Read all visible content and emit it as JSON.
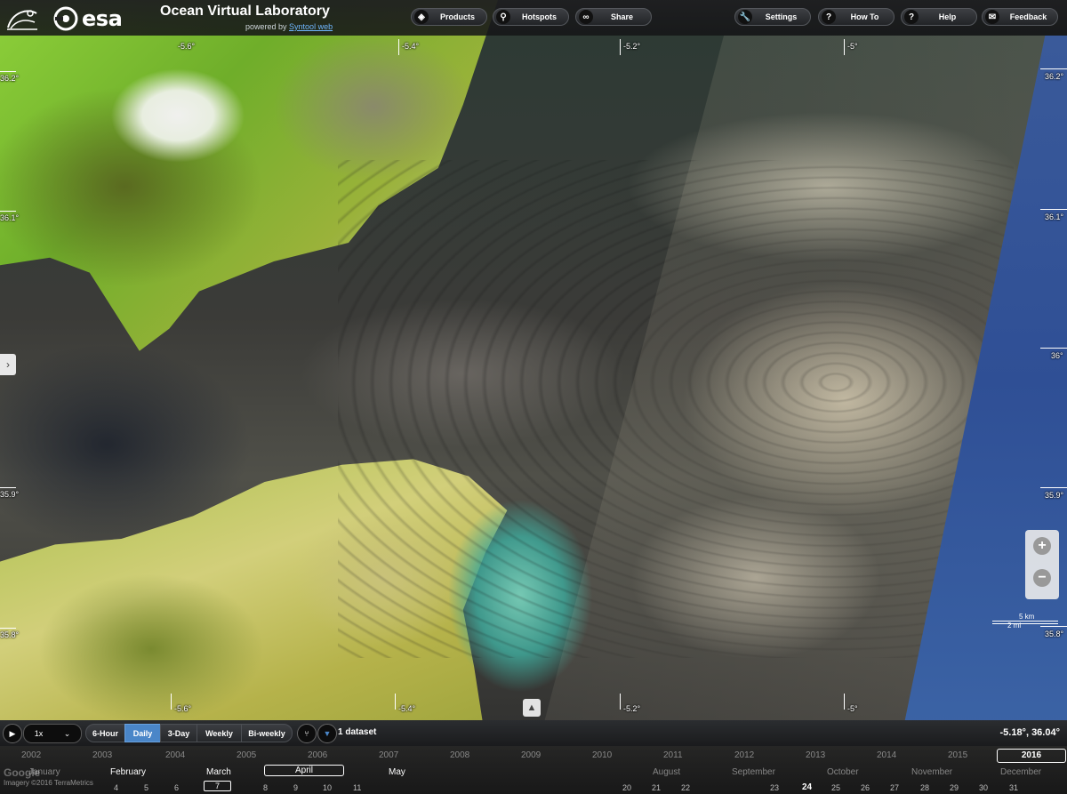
{
  "header": {
    "app_title": "Ocean Virtual Laboratory",
    "powered_by": "powered by",
    "powered_link": "Syntool web",
    "esa_logo_text": "esa",
    "buttons": {
      "products": "Products",
      "hotspots": "Hotspots",
      "share": "Share",
      "settings": "Settings",
      "howto": "How To",
      "help": "Help",
      "feedback": "Feedback"
    }
  },
  "grid": {
    "lon_top": [
      "-5.4°",
      "-5.2°",
      "-5°"
    ],
    "lat_right": [
      "36.2°",
      "36.1°",
      "36°",
      "35.9°",
      "35.8°"
    ],
    "lat_left": [
      "36.2°",
      "36.1°",
      "36°",
      "35.9°",
      "35.8°"
    ],
    "lon_bottom": [
      "-5.6°",
      "-5.4°",
      "-5.2°",
      "-5°"
    ],
    "lon_top_left": "-5.6°"
  },
  "map_overlay": {
    "scale_km": "5 km",
    "scale_mi": "2 mi"
  },
  "timeline_bar": {
    "speed": "1x",
    "periods": [
      "6-Hour",
      "Daily",
      "3-Day",
      "Weekly",
      "Bi-weekly"
    ],
    "active_period": "Daily",
    "datasets": "1 dataset",
    "cursor_position": "-5.18°, 36.04°"
  },
  "timeline": {
    "years": [
      "2002",
      "2003",
      "2004",
      "2005",
      "2006",
      "2007",
      "2008",
      "2009",
      "2010",
      "2011",
      "2012",
      "2013",
      "2014",
      "2015",
      "2016"
    ],
    "current_year": "2016",
    "months": [
      "January",
      "February",
      "March",
      "April",
      "May",
      "August",
      "September",
      "October",
      "November",
      "December"
    ],
    "selected_month": "April",
    "days": [
      "4",
      "5",
      "6",
      "7",
      "8",
      "9",
      "10",
      "11",
      "20",
      "21",
      "22",
      "23",
      "24",
      "25",
      "26",
      "27",
      "28",
      "29",
      "30",
      "31"
    ],
    "selected_day": "7",
    "highlight_day": "24",
    "map_credit": "Imagery ©2016 TerraMetrics",
    "google_mark": "Google"
  }
}
